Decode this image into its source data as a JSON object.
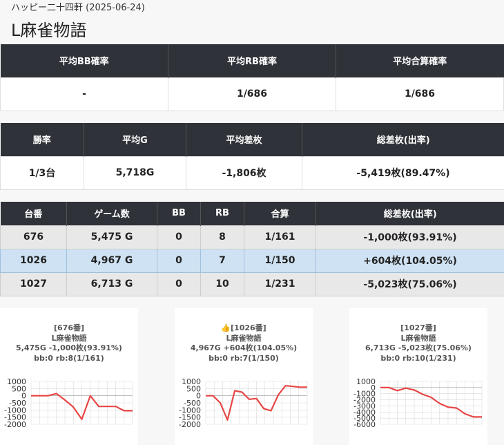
{
  "header": {
    "subtitle": "ハッピー二十四軒 (2025-06-24)",
    "title": "L麻雀物語"
  },
  "summary1": {
    "headers": [
      "平均BB確率",
      "平均RB確率",
      "平均合算確率"
    ],
    "values": [
      "-",
      "1/686",
      "1/686"
    ]
  },
  "summary2": {
    "headers": [
      "勝率",
      "平均G",
      "平均差枚",
      "総差枚(出率)"
    ],
    "values": [
      "1/3台",
      "5,718G",
      "-1,806枚",
      "-5,419枚(89.47%)"
    ]
  },
  "machines": {
    "headers": [
      "台番",
      "ゲーム数",
      "BB",
      "RB",
      "合算",
      "総差枚(出率)"
    ],
    "rows": [
      [
        "676",
        "5,475 G",
        "0",
        "8",
        "1/161",
        "-1,000枚(93.91%)"
      ],
      [
        "1026",
        "4,967 G",
        "0",
        "7",
        "1/150",
        "+604枚(104.05%)"
      ],
      [
        "1027",
        "6,713 G",
        "0",
        "10",
        "1/231",
        "-5,023枚(75.06%)"
      ]
    ]
  },
  "cards": [
    {
      "l1": "[676番]",
      "l2": "L麻雀物語",
      "l3": "5,475G -1,000枚(93.91%)",
      "l4": "bb:0 rb:8(1/161)"
    },
    {
      "l1": "👍[1026番]",
      "l2": "L麻雀物語",
      "l3": "4,967G +604枚(104.05%)",
      "l4": "bb:0 rb:7(1/150)"
    },
    {
      "l1": "[1027番]",
      "l2": "L麻雀物語",
      "l3": "6,713G -5,023枚(75.06%)",
      "l4": "bb:0 rb:10(1/231)"
    }
  ],
  "chart_data": [
    {
      "type": "line",
      "series_color": "#e84545",
      "yticks": [
        "1000",
        "500",
        "0",
        "-500",
        "-1000",
        "-1500",
        "-2000"
      ],
      "ylim": [
        -2000,
        1000
      ],
      "y": [
        0,
        0,
        0,
        150,
        -300,
        -800,
        -1650,
        0,
        -750,
        -750,
        -750,
        -1050,
        -1050
      ]
    },
    {
      "type": "line",
      "series_color": "#e84545",
      "yticks": [
        "1000",
        "500",
        "0",
        "-500",
        "-1000",
        "-1500",
        "-2000"
      ],
      "ylim": [
        -2000,
        1000
      ],
      "y": [
        0,
        0,
        -500,
        -1700,
        350,
        250,
        -250,
        -200,
        -900,
        -1050,
        50,
        700,
        650,
        600,
        600
      ]
    },
    {
      "type": "line",
      "series_color": "#e84545",
      "yticks": [
        "1000",
        "0",
        "-1000",
        "-2000",
        "-3000",
        "-4000",
        "-5000",
        "-6000"
      ],
      "ylim": [
        -6000,
        1000
      ],
      "y": [
        0,
        0,
        -500,
        -100,
        -400,
        -1100,
        -1600,
        -2600,
        -3200,
        -3350,
        -4300,
        -4800,
        -4800
      ]
    }
  ]
}
